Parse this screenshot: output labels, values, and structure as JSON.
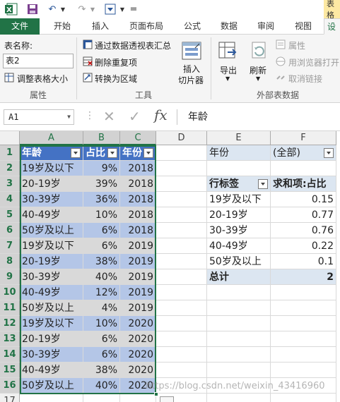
{
  "title_partial": "表格",
  "tabs": [
    "文件",
    "开始",
    "插入",
    "页面布局",
    "公式",
    "数据",
    "审阅",
    "视图",
    "设"
  ],
  "ribbon": {
    "table_name_label": "表名称:",
    "table_name_value": "表2",
    "resize_table": "调整表格大小",
    "group_properties": "属性",
    "pivot_summary": "通过数据透视表汇总",
    "remove_duplicates": "删除重复项",
    "convert_to_range": "转换为区域",
    "insert_slicer": [
      "插入",
      "切片器"
    ],
    "group_tools": "工具",
    "export": "导出",
    "refresh": "刷新",
    "properties": "属性",
    "open_in_browser": "用浏览器打开",
    "unlink": "取消链接",
    "group_external": "外部表数据"
  },
  "formula_bar": {
    "name_box": "A1",
    "fx": "fx",
    "content": "年龄"
  },
  "columns": [
    "A",
    "B",
    "C",
    "D",
    "E",
    "F"
  ],
  "rows": [
    "1",
    "2",
    "3",
    "4",
    "5",
    "6",
    "7",
    "8",
    "9",
    "10",
    "11",
    "12",
    "13",
    "14",
    "15",
    "16",
    "17"
  ],
  "table": {
    "headers": [
      "年龄",
      "占比",
      "年份"
    ],
    "rows": [
      [
        "19岁及以下",
        "9%",
        "2018"
      ],
      [
        "20-19岁",
        "39%",
        "2018"
      ],
      [
        "30-39岁",
        "36%",
        "2018"
      ],
      [
        "40-49岁",
        "10%",
        "2018"
      ],
      [
        "50岁及以上",
        "6%",
        "2018"
      ],
      [
        "19岁及以下",
        "6%",
        "2019"
      ],
      [
        "20-19岁",
        "38%",
        "2019"
      ],
      [
        "30-39岁",
        "40%",
        "2019"
      ],
      [
        "40-49岁",
        "12%",
        "2019"
      ],
      [
        "50岁及以上",
        "4%",
        "2019"
      ],
      [
        "19岁及以下",
        "10%",
        "2020"
      ],
      [
        "20-19岁",
        "6%",
        "2020"
      ],
      [
        "30-39岁",
        "6%",
        "2020"
      ],
      [
        "40-49岁",
        "38%",
        "2020"
      ],
      [
        "50岁及以上",
        "40%",
        "2020"
      ]
    ]
  },
  "pivot": {
    "filter_label": "年份",
    "filter_value": "(全部)",
    "row_label": "行标签",
    "value_label": "求和项:占比",
    "rows": [
      [
        "19岁及以下",
        "0.15"
      ],
      [
        "20-19岁",
        "0.77"
      ],
      [
        "30-39岁",
        "0.76"
      ],
      [
        "40-49岁",
        "0.22"
      ],
      [
        "50岁及以上",
        "0.1"
      ]
    ],
    "total_label": "总计",
    "total_value": "2"
  },
  "watermark": "https://blog.csdn.net/weixin_43416960",
  "colors": {
    "excel_green": "#217346",
    "table_header": "#4472c4",
    "band_blue": "#b4c6e7",
    "band_gray": "#d9d9d9",
    "pivot_header": "#dce6f1"
  }
}
